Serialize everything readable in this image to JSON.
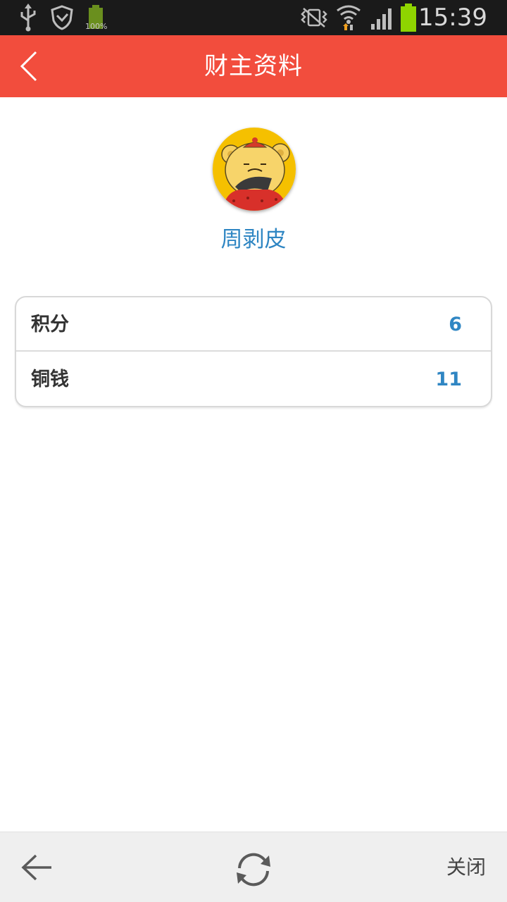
{
  "status_bar": {
    "time": "15:39",
    "battery_percent_label": "100%",
    "icons": [
      "usb-icon",
      "shield-icon",
      "battery-small-icon",
      "mute-vibrate-icon",
      "wifi-icon",
      "signal-icon",
      "battery-icon"
    ],
    "colors": {
      "background": "#1a1a1a",
      "battery_fill": "#8fd400"
    }
  },
  "header": {
    "title": "财主资料",
    "back_icon": "chevron-left-icon",
    "background": "#f24d3d"
  },
  "profile": {
    "avatar_icon": "cartoon-avatar-icon",
    "name": "周剥皮"
  },
  "info": {
    "rows": [
      {
        "label": "积分",
        "value": "6"
      },
      {
        "label": "铜钱",
        "value": "11"
      }
    ],
    "value_color": "#2f86c3"
  },
  "bottom_bar": {
    "back_icon": "arrow-left-icon",
    "refresh_icon": "refresh-icon",
    "close_label": "关闭"
  }
}
